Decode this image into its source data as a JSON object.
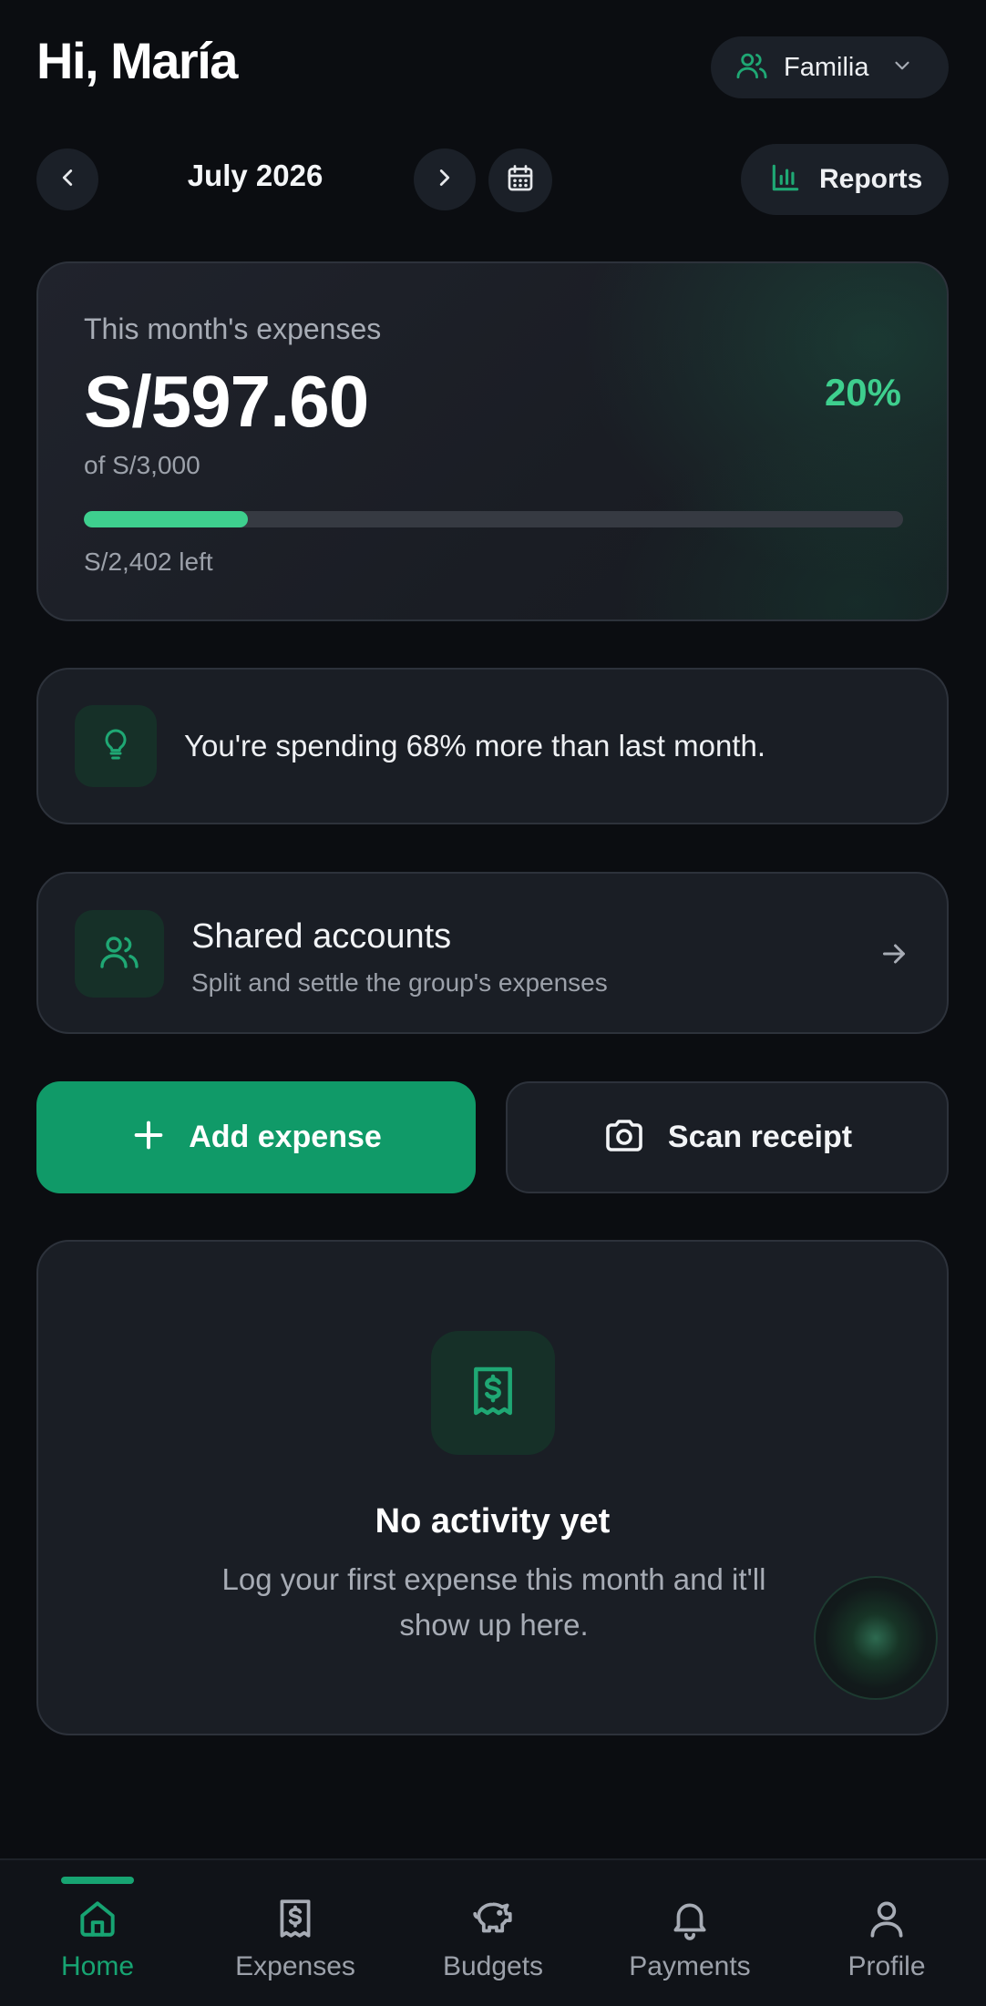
{
  "header": {
    "greeting": "Hi, María",
    "group_label": "Familia"
  },
  "month_nav": {
    "month": "July 2026",
    "reports_label": "Reports"
  },
  "summary": {
    "label": "This month's expenses",
    "amount": "S/597.60",
    "percent": "20%",
    "budget_text": "of S/3,000",
    "progress_fraction": 0.2,
    "remaining_text": "S/2,402 left"
  },
  "insight": {
    "text": "You're spending 68% more than last month."
  },
  "shared": {
    "title": "Shared accounts",
    "subtitle": "Split and settle the group's expenses"
  },
  "actions": {
    "add_label": "Add expense",
    "scan_label": "Scan receipt"
  },
  "empty_state": {
    "title": "No activity yet",
    "description": "Log your first expense this month and it'll show up here."
  },
  "bottom_nav": {
    "items": [
      {
        "label": "Home",
        "icon": "home-icon",
        "active": true
      },
      {
        "label": "Expenses",
        "icon": "receipt-icon",
        "active": false
      },
      {
        "label": "Budgets",
        "icon": "piggy-bank-icon",
        "active": false
      },
      {
        "label": "Payments",
        "icon": "bell-icon",
        "active": false
      },
      {
        "label": "Profile",
        "icon": "user-icon",
        "active": false
      }
    ]
  },
  "colors": {
    "accent": "#3ecf8e",
    "primary_button": "#109a68",
    "background": "#0b0d11",
    "card": "#1a1e25"
  }
}
